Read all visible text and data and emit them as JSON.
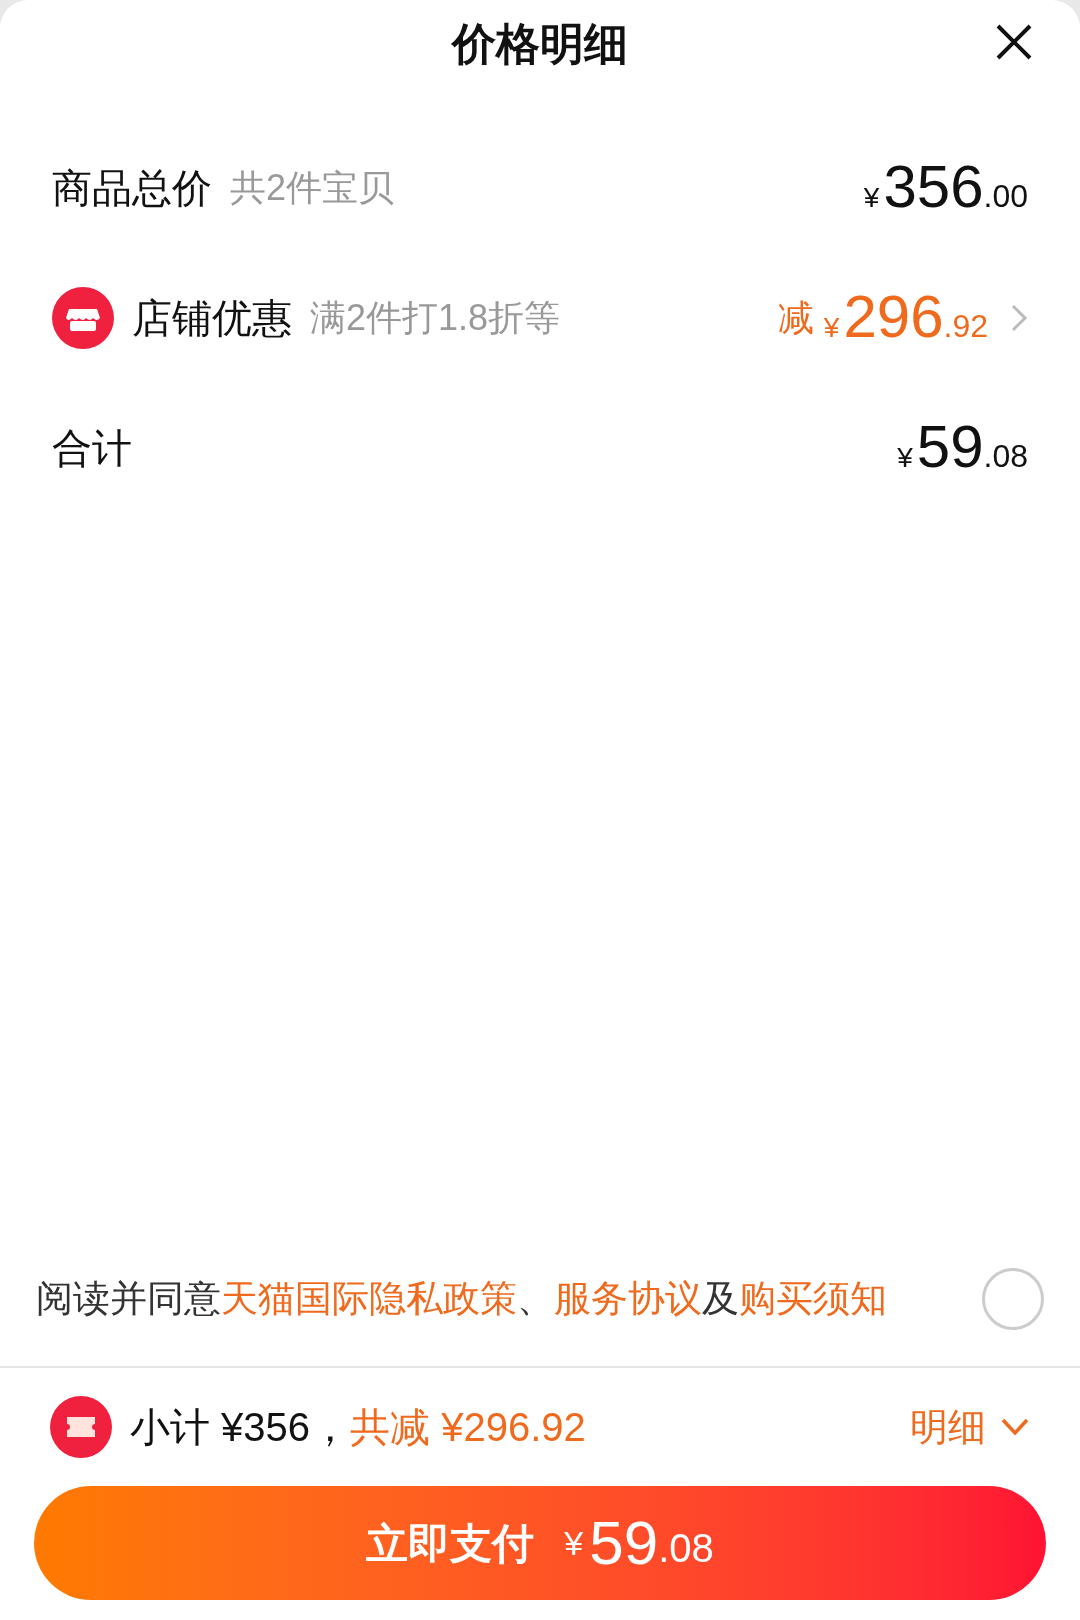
{
  "sheet": {
    "title": "价格明细"
  },
  "rows": [
    {
      "kind": "plain",
      "label": "商品总价",
      "note": "共2件宝贝",
      "price": {
        "currency": "¥",
        "integer": "356",
        "decimal": ".00"
      }
    },
    {
      "kind": "discount",
      "label": "店铺优惠",
      "note": "满2件打1.8折等",
      "prefix": "减",
      "price": {
        "currency": "¥",
        "integer": "296",
        "decimal": ".92"
      }
    },
    {
      "kind": "plain",
      "label": "合计",
      "price": {
        "currency": "¥",
        "integer": "59",
        "decimal": ".08"
      }
    }
  ],
  "agreement": {
    "parts": [
      {
        "kind": "text",
        "text": "阅读并同意"
      },
      {
        "kind": "link",
        "text": "天猫国际隐私政策"
      },
      {
        "kind": "text",
        "text": "、"
      },
      {
        "kind": "link",
        "text": "服务协议"
      },
      {
        "kind": "text",
        "text": "及"
      },
      {
        "kind": "link",
        "text": "购买须知"
      }
    ],
    "checked": false
  },
  "summary": {
    "subtotal": "小计 ¥356，",
    "saving": "共减 ¥296.92",
    "details": "明细"
  },
  "pay_button": {
    "label": "立即支付",
    "currency": "¥",
    "integer": "59",
    "decimal": ".08"
  }
}
